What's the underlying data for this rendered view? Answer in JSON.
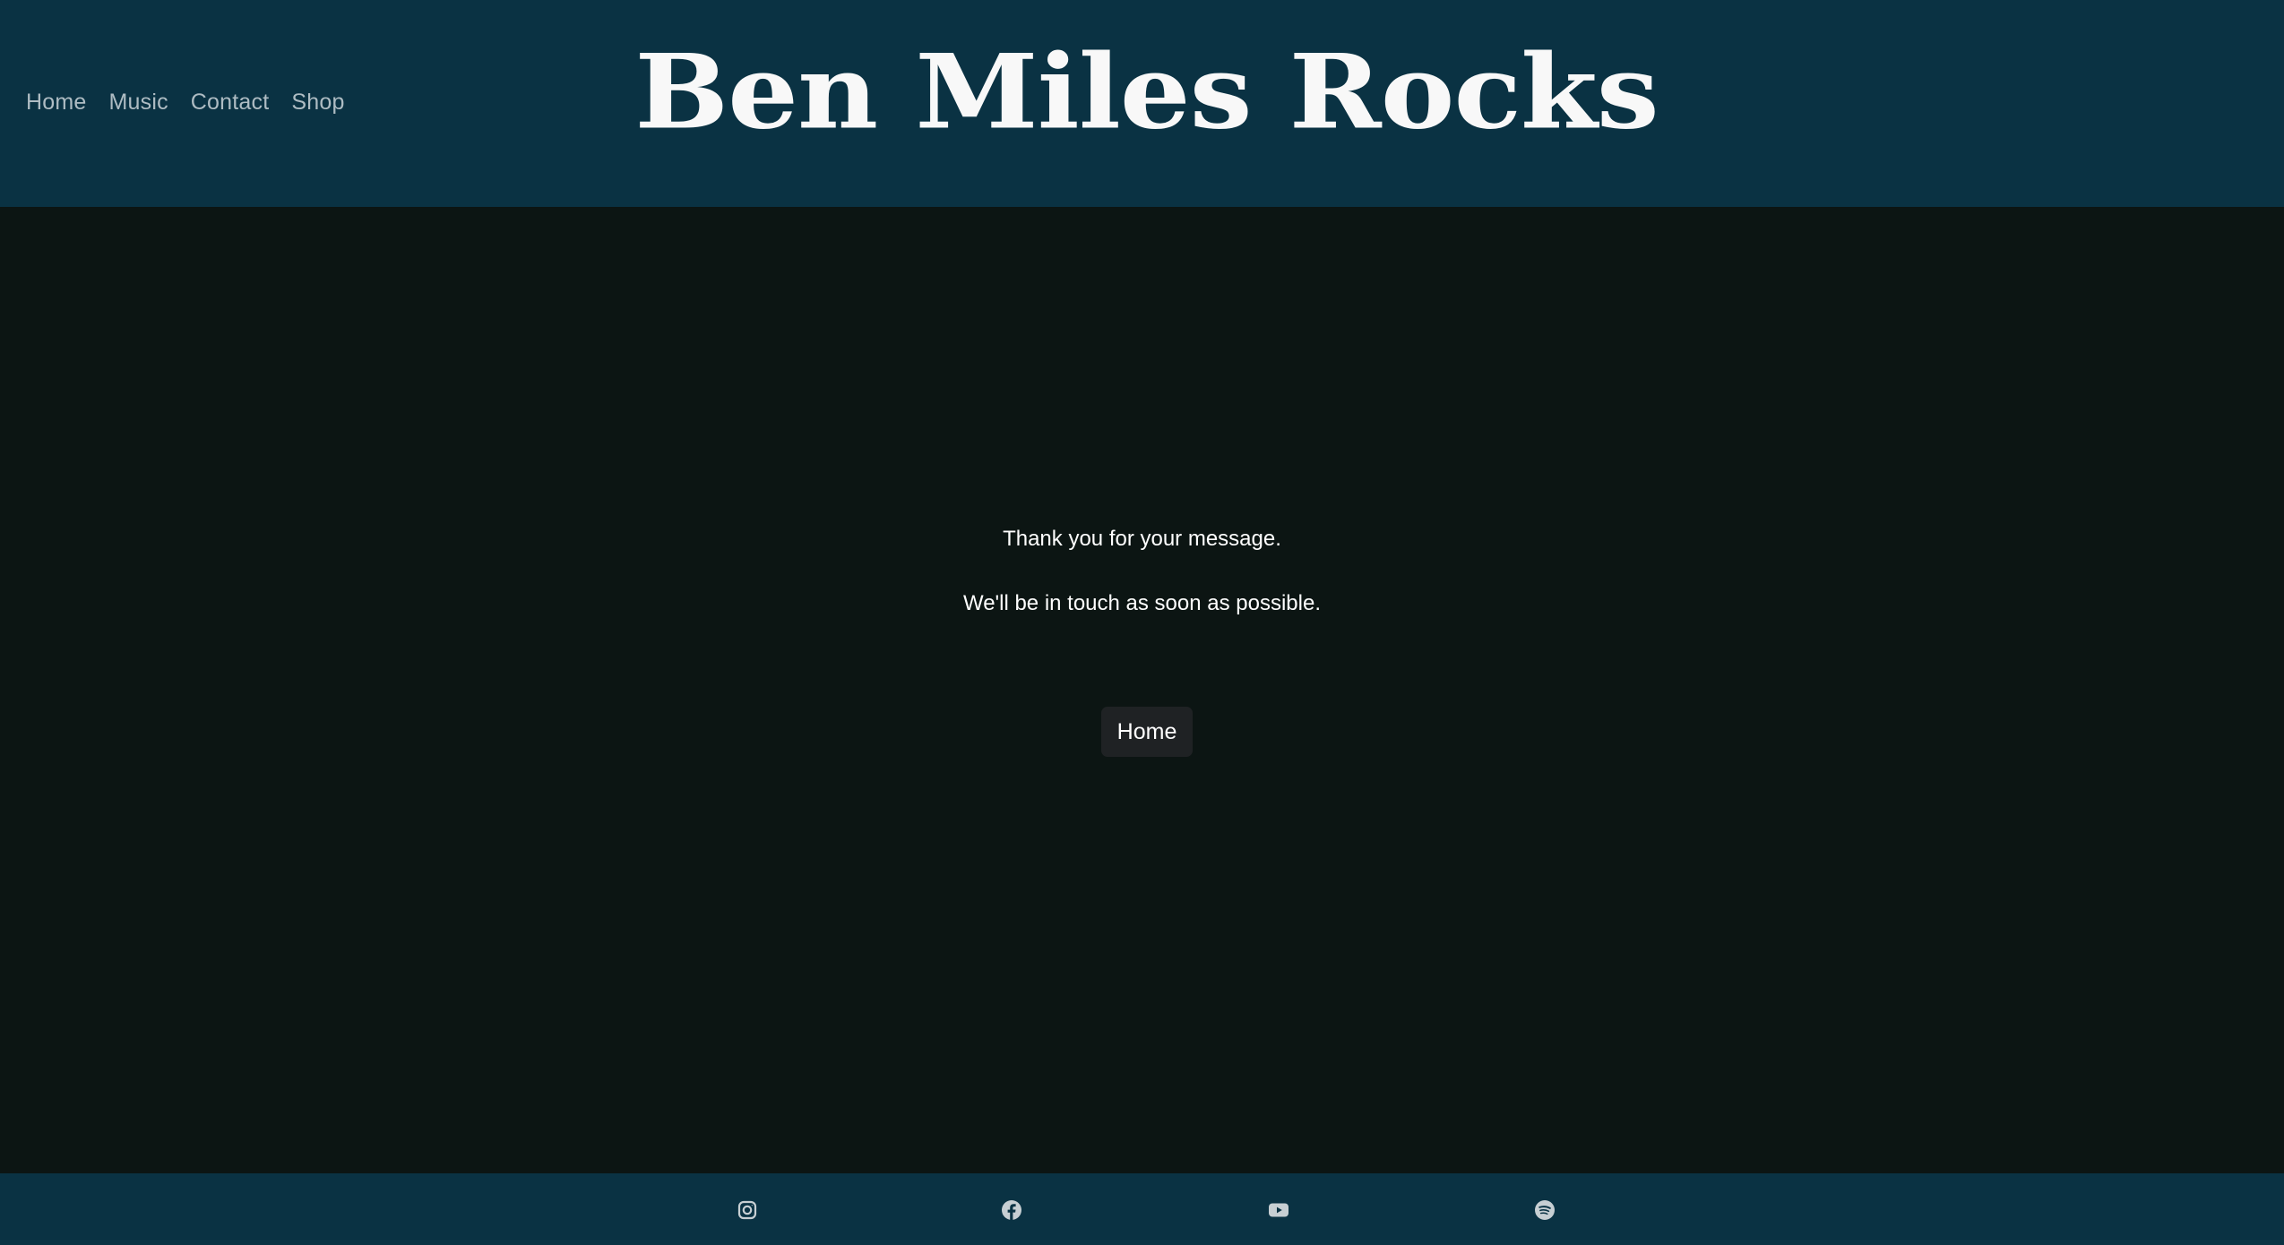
{
  "header": {
    "site_title": "Ben Miles Rocks",
    "nav": [
      {
        "label": "Home"
      },
      {
        "label": "Music"
      },
      {
        "label": "Contact"
      },
      {
        "label": "Shop"
      }
    ]
  },
  "main": {
    "thank_you": "Thank you for your message.",
    "follow_up": "We'll be in touch as soon as possible.",
    "home_button": "Home"
  },
  "footer": {
    "social_icons": [
      "instagram-icon",
      "facebook-icon",
      "youtube-icon",
      "spotify-icon"
    ]
  },
  "colors": {
    "header_bg": "#0a3243",
    "main_bg": "#0c1513",
    "nav_text": "#aebcc3",
    "title_text": "#f8f8f8",
    "button_bg": "#1f2224",
    "icon_color": "#c7cfd3"
  }
}
